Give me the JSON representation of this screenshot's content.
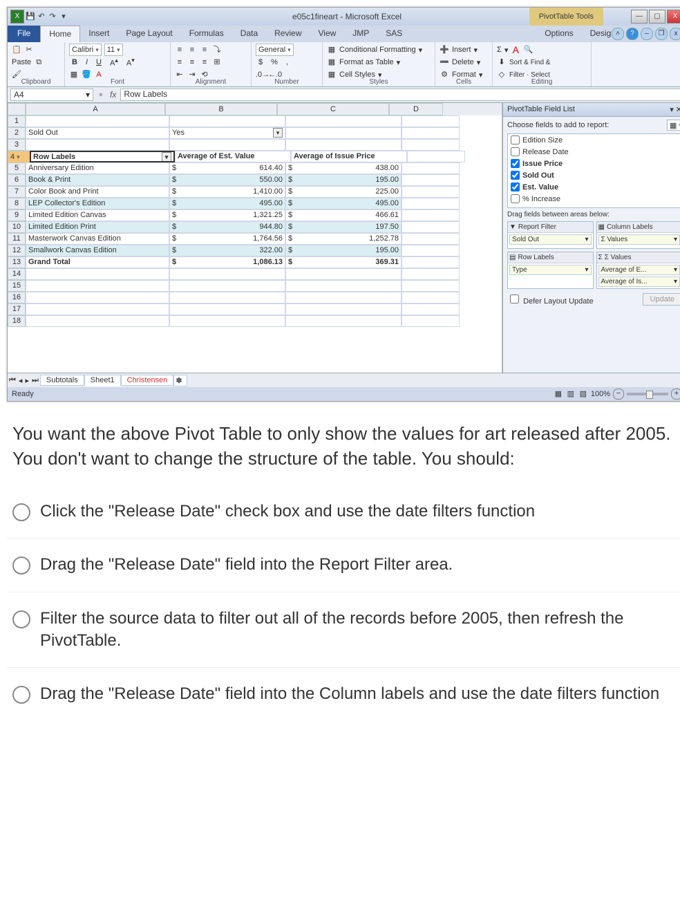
{
  "title": "e05c1fineart - Microsoft Excel",
  "pt_tools": "PivotTable Tools",
  "win": {
    "min": "—",
    "max": "▢",
    "close": "X"
  },
  "tabs": {
    "file": "File",
    "list": [
      "Home",
      "Insert",
      "Page Layout",
      "Formulas",
      "Data",
      "Review",
      "View",
      "JMP",
      "SAS"
    ],
    "right": [
      "Options",
      "Design"
    ]
  },
  "ribbon": {
    "clipboard": {
      "label": "Clipboard",
      "paste": "Paste"
    },
    "font": {
      "label": "Font",
      "name": "Calibri",
      "size": "11",
      "bold": "B",
      "italic": "I",
      "under": "U",
      "grow": "A",
      "shrink": "A"
    },
    "alignment": {
      "label": "Alignment"
    },
    "number": {
      "label": "Number",
      "fmt": "General",
      "cur": "$",
      "pct": "%",
      "comma": ","
    },
    "styles": {
      "label": "Styles",
      "cond": "Conditional Formatting",
      "fmt_tbl": "Format as Table",
      "cell": "Cell Styles"
    },
    "cells": {
      "label": "Cells",
      "ins": "Insert",
      "del": "Delete",
      "fmt": "Format"
    },
    "editing": {
      "label": "Editing",
      "sigma": "Σ",
      "sort": "Sort & Find &",
      "filter": "Filter · Select"
    }
  },
  "namebox": "A4",
  "fx": "fx",
  "formula": "Row Labels",
  "cols": [
    "A",
    "B",
    "C",
    "D"
  ],
  "rows": [
    {
      "n": "1",
      "a": "",
      "b": "",
      "c": ""
    },
    {
      "n": "2",
      "a": "Sold Out",
      "b": "Yes",
      "c": ""
    },
    {
      "n": "3",
      "a": "",
      "b": "",
      "c": ""
    },
    {
      "n": "4",
      "a": "Row Labels",
      "b": "Average of Est. Value",
      "c": "Average of Issue Price"
    },
    {
      "n": "5",
      "a": "Anniversary Edition",
      "b": "614.40",
      "c": "438.00"
    },
    {
      "n": "6",
      "a": "Book & Print",
      "b": "550.00",
      "c": "195.00"
    },
    {
      "n": "7",
      "a": "Color Book and Print",
      "b": "1,410.00",
      "c": "225.00"
    },
    {
      "n": "8",
      "a": "LEP Collector's Edition",
      "b": "495.00",
      "c": "495.00"
    },
    {
      "n": "9",
      "a": "Limited Edition Canvas",
      "b": "1,321.25",
      "c": "466.61"
    },
    {
      "n": "10",
      "a": "Limited Edition Print",
      "b": "944.80",
      "c": "197.50"
    },
    {
      "n": "11",
      "a": "Masterwork Canvas Edition",
      "b": "1,764.56",
      "c": "1,252.78"
    },
    {
      "n": "12",
      "a": "Smallwork Canvas Edition",
      "b": "322.00",
      "c": "195.00"
    },
    {
      "n": "13",
      "a": "Grand Total",
      "b": "1,086.13",
      "c": "369.31"
    },
    {
      "n": "14"
    },
    {
      "n": "15"
    },
    {
      "n": "16"
    },
    {
      "n": "17"
    },
    {
      "n": "18"
    }
  ],
  "dollar": "$",
  "fieldlist": {
    "title": "PivotTable Field List",
    "choose": "Choose fields to add to report:",
    "fields": [
      {
        "label": "Edition Size",
        "ck": false
      },
      {
        "label": "Release Date",
        "ck": false
      },
      {
        "label": "Issue Price",
        "ck": true
      },
      {
        "label": "Sold Out",
        "ck": true
      },
      {
        "label": "Est. Value",
        "ck": true
      },
      {
        "label": "% Increase",
        "ck": false
      }
    ],
    "drag": "Drag fields between areas below:",
    "zones": {
      "rf": {
        "h": "Report Filter",
        "items": [
          "Sold Out"
        ]
      },
      "cl": {
        "h": "Column Labels",
        "items": [
          "Σ Values"
        ]
      },
      "rl": {
        "h": "Row Labels",
        "items": [
          "Type"
        ]
      },
      "vl": {
        "h": "Σ  Values",
        "items": [
          "Average of E...",
          "Average of Is..."
        ]
      }
    },
    "defer": "Defer Layout Update",
    "update": "Update"
  },
  "sheets": {
    "nav": "◂◂ ◂ ▸ ▸▸",
    "tabs": [
      "Subtotals",
      "Sheet1",
      "Christensen"
    ]
  },
  "status": {
    "ready": "Ready",
    "zoom": "100%"
  },
  "question": "You want the above Pivot Table to only show the values for art released after 2005.  You don't want to change the structure of the table.   You should:",
  "opts": [
    "Click the \"Release Date\" check box and use the date filters function",
    "Drag the \"Release Date\" field into the Report Filter area.",
    "Filter the source data to filter out all of the records before 2005, then refresh the PivotTable.",
    "Drag the \"Release Date\" field into the Column labels and use the date filters function"
  ]
}
